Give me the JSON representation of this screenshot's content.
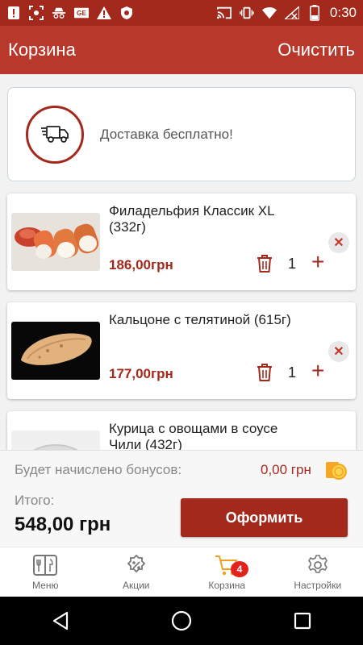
{
  "status_bar": {
    "time": "0:30",
    "icons": [
      "alert-icon",
      "screenshot-icon",
      "incognito-icon",
      "ge-icon",
      "warning-icon",
      "shield-icon",
      "cast-icon",
      "vibrate-icon",
      "wifi-icon",
      "no-sim-icon",
      "battery-icon"
    ]
  },
  "app_bar": {
    "title": "Корзина",
    "clear_label": "Очистить"
  },
  "delivery": {
    "text": "Доставка бесплатно!"
  },
  "items": [
    {
      "name": "Филадельфия Классик  XL (332г)",
      "price": "186,00грн",
      "qty": "1"
    },
    {
      "name": "Кальцоне с телятиной (615г)",
      "price": "177,00грн",
      "qty": "1"
    },
    {
      "name": "Курица с овощами в  соусе Чили  (432г)",
      "price": "",
      "qty": ""
    }
  ],
  "summary": {
    "bonus_label": "Будет начислено бонусов:",
    "bonus_value": "0,00 грн",
    "total_label": "Итого:",
    "total_value": "548,00 грн",
    "checkout_label": "Оформить"
  },
  "bottom_nav": {
    "items": [
      {
        "label": "Меню",
        "icon": "menu-book-icon"
      },
      {
        "label": "Акции",
        "icon": "discount-icon"
      },
      {
        "label": "Корзина",
        "icon": "cart-icon",
        "badge": "4"
      },
      {
        "label": "Настройки",
        "icon": "gear-icon"
      }
    ]
  },
  "colors": {
    "primary": "#b8392b",
    "primary_dark": "#a3291d",
    "badge": "#e3231b"
  }
}
